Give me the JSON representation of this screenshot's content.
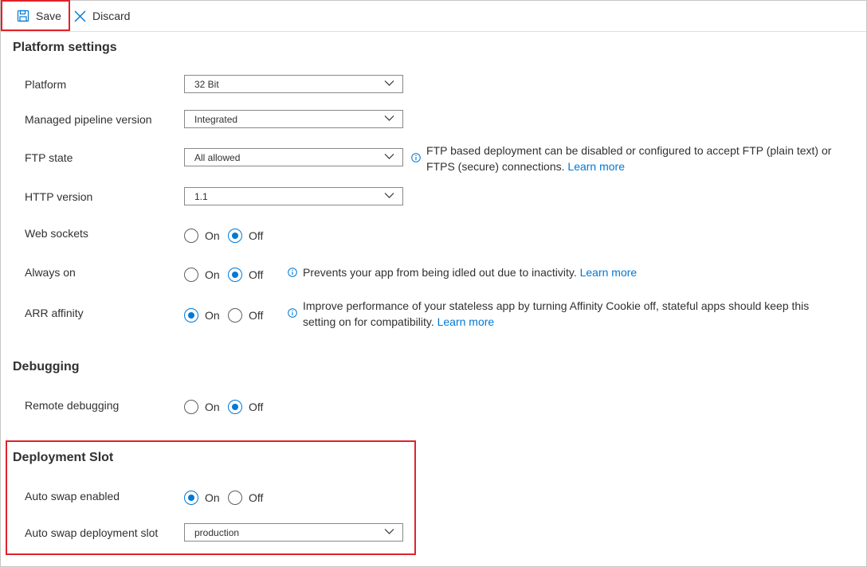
{
  "toolbar": {
    "save_label": "Save",
    "discard_label": "Discard"
  },
  "platform": {
    "title": "Platform settings",
    "platform_label": "Platform",
    "platform_value": "32 Bit",
    "pipeline_label": "Managed pipeline version",
    "pipeline_value": "Integrated",
    "ftp_label": "FTP state",
    "ftp_value": "All allowed",
    "ftp_info_line1": "FTP based deployment can be disabled or configured to accept FTP (plain text) or",
    "ftp_info_line2": "FTPS (secure) connections.",
    "http_label": "HTTP version",
    "http_value": "1.1",
    "websockets_label": "Web sockets",
    "websockets_selected": "Off",
    "alwayson_label": "Always on",
    "alwayson_selected": "Off",
    "alwayson_info": "Prevents your app from being idled out due to inactivity.",
    "arr_label": "ARR affinity",
    "arr_selected": "On",
    "arr_info_line1": "Improve performance of your stateless app by turning Affinity Cookie off, stateful apps should keep this",
    "arr_info_line2": "setting on for compatibility."
  },
  "debugging": {
    "title": "Debugging",
    "remote_label": "Remote debugging",
    "remote_selected": "Off"
  },
  "deployment": {
    "title": "Deployment Slot",
    "autoswap_label": "Auto swap enabled",
    "autoswap_selected": "On",
    "slot_label": "Auto swap deployment slot",
    "slot_value": "production"
  },
  "common": {
    "on": "On",
    "off": "Off",
    "learn_more": "Learn more"
  },
  "colors": {
    "accent": "#0078d4",
    "highlight": "#e0222a"
  },
  "icons": {
    "save": "floppy-disk-icon",
    "discard": "close-x-icon",
    "dropdown": "chevron-down-icon",
    "info": "info-circle-icon"
  }
}
